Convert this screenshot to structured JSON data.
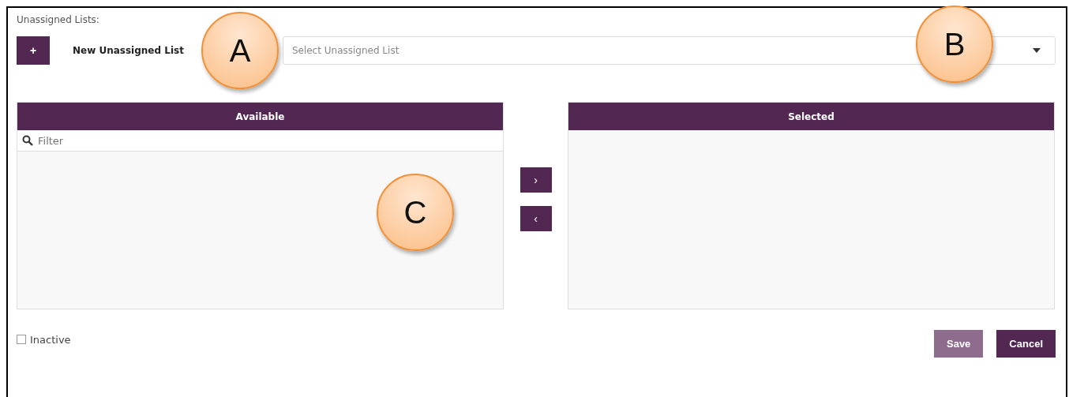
{
  "heading": "Unassigned Lists:",
  "new_button": {
    "icon": "+",
    "label": "New Unassigned List"
  },
  "select": {
    "placeholder": "Select Unassigned List"
  },
  "available": {
    "title": "Available",
    "filter_placeholder": "Filter"
  },
  "move_buttons": [
    {
      "glyph": "›"
    },
    {
      "glyph": "‹"
    }
  ],
  "selected_panel": {
    "title": "Selected"
  },
  "inactive": {
    "label": "Inactive",
    "checked": false
  },
  "buttons": [
    {
      "label": "Save",
      "disabled": true
    },
    {
      "label": "Cancel",
      "disabled": false
    }
  ],
  "callouts": [
    {
      "letter": "A"
    },
    {
      "letter": "B"
    },
    {
      "letter": "C"
    }
  ]
}
